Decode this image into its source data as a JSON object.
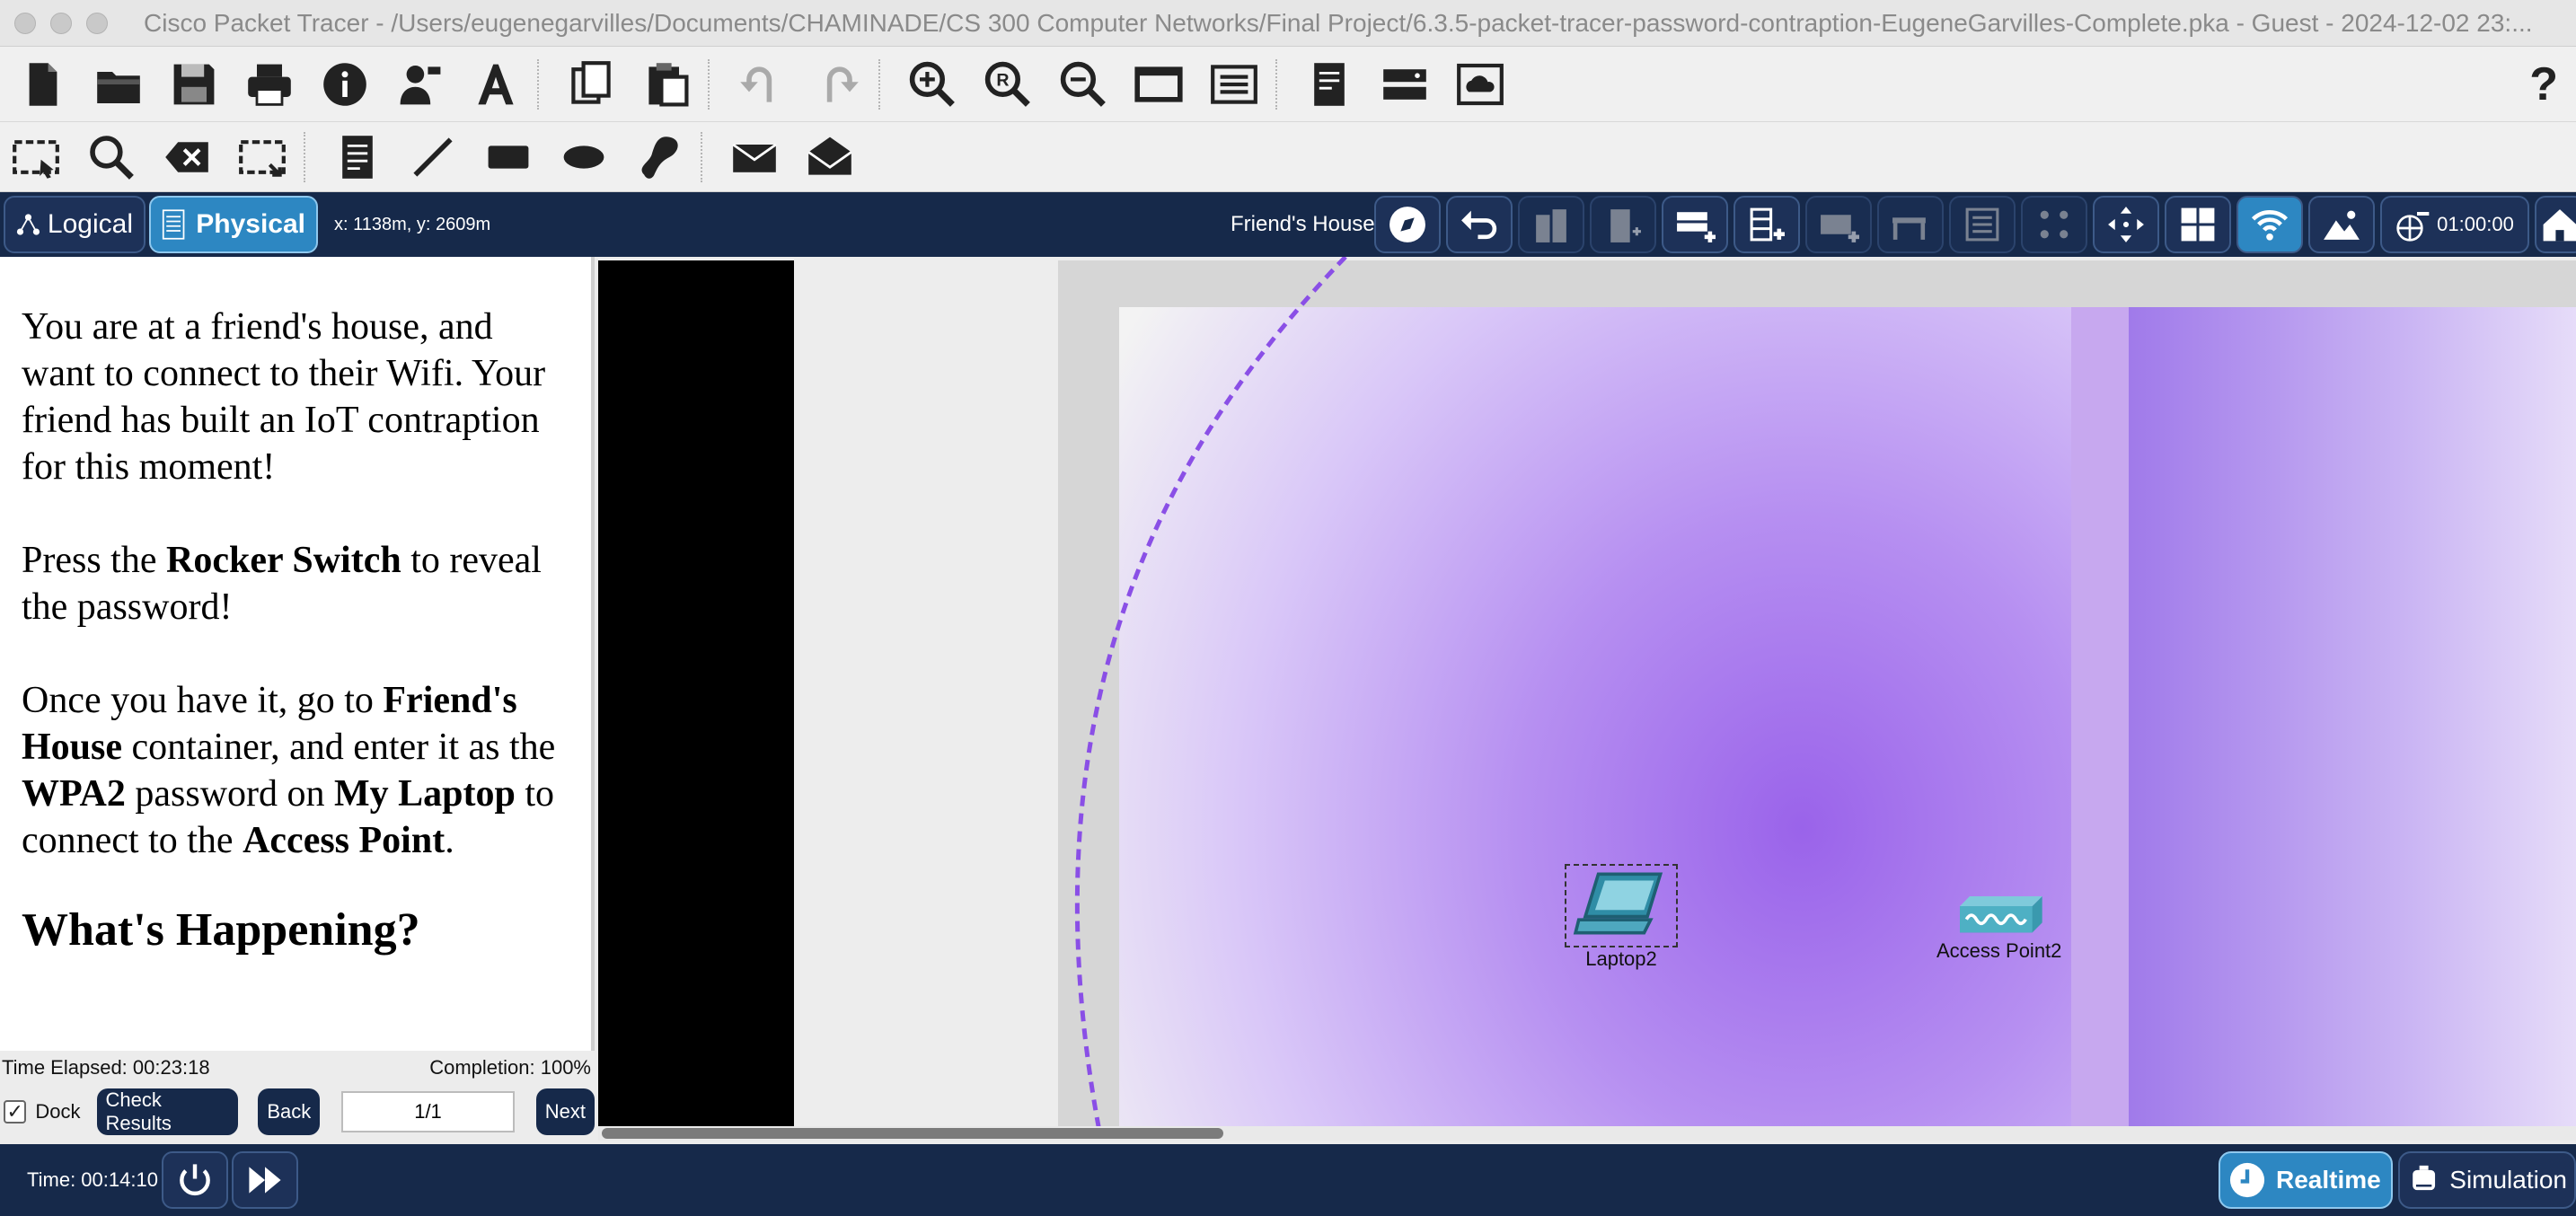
{
  "window": {
    "title": "Cisco Packet Tracer - /Users/eugenegarvilles/Documents/CHAMINADE/CS 300 Computer Networks/Final Project/6.3.5-packet-tracer-password-contraption-EugeneGarvilles-Complete.pka - Guest - 2024-12-02 23:..."
  },
  "toolbar1": {
    "icons": [
      "new-file-icon",
      "open-folder-icon",
      "save-icon",
      "print-icon",
      "info-icon",
      "activity-wizard-icon",
      "text-tool-icon",
      "copy-icon",
      "paste-icon",
      "undo-icon",
      "redo-icon",
      "zoom-in-icon",
      "zoom-reset-icon",
      "zoom-out-icon",
      "window-icon",
      "palette-icon",
      "notes-icon",
      "device-icon",
      "cloud-icon"
    ],
    "help_label": "?"
  },
  "toolbar2": {
    "icons": [
      "select-icon",
      "inspect-icon",
      "delete-icon",
      "resize-icon",
      "note-icon",
      "line-icon",
      "rectangle-icon",
      "ellipse-icon",
      "freeform-icon",
      "simple-pdu-icon",
      "complex-pdu-icon"
    ]
  },
  "navbar": {
    "logical_label": "Logical",
    "physical_label": "Physical",
    "coordinates": "x: 1138m, y: 2609m",
    "container_label": "Friend's House",
    "clock": "01:00:00"
  },
  "instructions": {
    "para1": "You are at a friend's house, and want to connect to their Wifi. Your friend has built an IoT contraption for this moment!",
    "para2_a": "Press the ",
    "para2_b": "Rocker Switch",
    "para2_c": " to reveal the password!",
    "para3_a": "Once you have it, go to ",
    "para3_b": "Friend's House",
    "para3_c": " container, and enter it as the ",
    "para3_d": "WPA2",
    "para3_e": " password on ",
    "para3_f": "My Laptop",
    "para3_g": " to connect to the ",
    "para3_h": "Access Point",
    "para3_i": ".",
    "heading": "What's Happening?"
  },
  "activity": {
    "time_elapsed": "Time Elapsed: 00:23:18",
    "completion": "Completion: 100%",
    "dock_label": "Dock",
    "dock_checked": "✓",
    "check_results_label": "Check Results",
    "back_label": "Back",
    "page": "1/1",
    "next_label": "Next"
  },
  "devices": {
    "laptop_label": "Laptop2",
    "ap_label": "Access Point2"
  },
  "statusbar": {
    "time": "Time: 00:14:10",
    "realtime_label": "Realtime",
    "simulation_label": "Simulation"
  },
  "colors": {
    "navy": "#16294a",
    "accent_blue": "#2d87c2",
    "wifi_range": "#8a4fe6"
  }
}
